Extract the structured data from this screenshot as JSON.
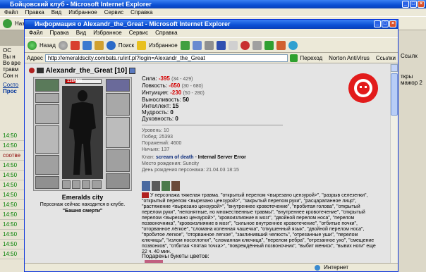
{
  "bg_window": {
    "title": "Бойцовский клуб - Microsoft Internet Explorer",
    "menu": [
      "Файл",
      "Правка",
      "Вид",
      "Избранное",
      "Сервис",
      "Справка"
    ],
    "back_label": "Наза",
    "left_lines": [
      "OC",
      "Вы н",
      "Во вре",
      "травм",
      "Сон н"
    ],
    "left_links": [
      "Состо",
      "Прос"
    ],
    "chat_times": [
      "14:50",
      "14:50",
      "14:50",
      "14:50",
      "14:50",
      "14:50",
      "14:50",
      "14:50",
      "14:50",
      "14:50",
      "14:50",
      "14:50"
    ],
    "chat_mid": "соотве",
    "right_snip": [
      "Ссылк",
      "ткры",
      "мажор 2"
    ],
    "links_label": "Ссылки"
  },
  "popup": {
    "title": "Информация о Alexandr_the_Great - Microsoft Internet Explorer",
    "menu": [
      "Файл",
      "Правка",
      "Вид",
      "Избранное",
      "Сервис",
      "Справка"
    ],
    "back_label": "Назад",
    "search_label": "Поиск",
    "fav_label": "Избранное",
    "address_label": "Адрес",
    "url": "http://emeraldscity.combats.ru/inf.pl?login=Alexandr_the_Great",
    "go_label": "Переход",
    "norton_label": "Norton AntiVirus",
    "links_label": "Ссылки",
    "status_text": "Интернет",
    "colors": {
      "xp_blue": "#0a4fd4",
      "menu_bg": "#ece9d8",
      "page_bg": "#e4e4e4",
      "red_stat": "#d40000",
      "hp_bar": "#c00000"
    }
  },
  "character": {
    "name": "Alexandr_the_Great",
    "level": "[10]",
    "hp": "118/436",
    "hp_fraction": 0.27,
    "city": "Emeralds city",
    "location_line1": "Персонаж сейчас находится в клубе.",
    "location_line2": "\"Башня смерти\"",
    "stats": [
      {
        "label": "Сила:",
        "value": "-395",
        "extra": "(34 - 429)",
        "red": true
      },
      {
        "label": "Ловкость:",
        "value": "-650",
        "extra": "(30 - 680)",
        "red": true
      },
      {
        "label": "Интуиция:",
        "value": "-230",
        "extra": "(50 - 280)",
        "red": true
      },
      {
        "label": "Выносливость:",
        "value": "50",
        "extra": "",
        "red": false
      },
      {
        "label": "Интеллект:",
        "value": "15",
        "extra": "",
        "red": false
      },
      {
        "label": "Мудрость:",
        "value": "0",
        "extra": "",
        "red": false
      },
      {
        "label": "Духовность:",
        "value": "0",
        "extra": "",
        "red": false
      }
    ],
    "info": [
      "Уровень: 10",
      "Побед: 25393",
      "Поражений: 4600",
      "Ничьих: 137"
    ],
    "clan_label": "Клан:",
    "clan_name": "scream of death",
    "clan_sep": " - ",
    "clan_role": "Internal Server Error",
    "birthplace": "Место рождения: Suncity",
    "birthday": "День рождения персонажа: 21.04.03 18:15",
    "trauma_text": "У персонажа тяжелая травма. \"открытый перелом <вырезано цензурой>\", \"разрыв селезенки\", \"открытый перелом <вырезано цензурой>\", \"закрытый перелом руки\", \"расцарапанное лицо\", \"растяжение <вырезано цензурой>\", \"внутреннее кровотечение\", \"пробитая голова\", \"открытый перелом руки\", \"непонятные, но множественные травмы\", \"внутреннее кровотечение\", \"открытый перелом <вырезано цензурой>\", \"кровоизлияние в мозг\", \"двойной перелом носа\", \"перелом позвоночника\", \"кровоизлияние в мозг\", \"сильное внутреннее кровотечение\", \"отбитые почки\", \"оторванное лёгкое\", \"сломана коленная чашечка\", \"откушенный язык\", \"двойной перелом носа\", \"пробитое легкое\", \"оторванное легкое\", \"заклинивший челюсть\", \"отрезанные уши\", \"перелом ключицы\", \"излом носоглотки\", \"сломанная ключица\", \"перелом ребра\", \"отрезанное ухо\", \"смещение позвонков\", \"отбитая <пятая точка>\", \"повреждённый позвоночник\", \"выбит мениск\", \"вывих ноги\" еще 22 ч. 40 мин.",
    "gifts_label": "Подарены букеты цветов:"
  }
}
